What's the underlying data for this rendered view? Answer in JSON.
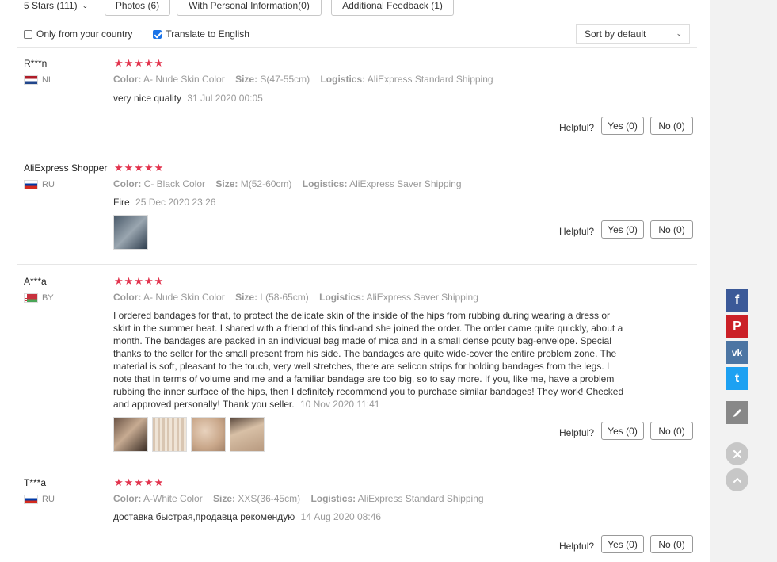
{
  "filters": {
    "stars": "5 Stars (111)",
    "photos": "Photos (6)",
    "personal": "With Personal Information(0)",
    "feedback": "Additional Feedback (1)"
  },
  "options": {
    "only_country": "Only from your country",
    "translate": "Translate to English",
    "sort": "Sort by default"
  },
  "labels": {
    "color": "Color:",
    "size": "Size:",
    "logistics": "Logistics:",
    "helpful": "Helpful?"
  },
  "reviews": [
    {
      "user": "R***n",
      "country": "NL",
      "stars": "★★★★★",
      "color": "A- Nude Skin Color",
      "size": "S(47-55cm)",
      "logistics": "AliExpress Standard Shipping",
      "text": "very nice quality",
      "date": "31 Jul 2020 00:05",
      "yes": "Yes (0)",
      "no": "No (0)"
    },
    {
      "user": "AliExpress Shopper",
      "country": "RU",
      "stars": "★★★★★",
      "color": "C- Black Color",
      "size": "M(52-60cm)",
      "logistics": "AliExpress Saver Shipping",
      "text": "Fire",
      "date": "25 Dec 2020 23:26",
      "yes": "Yes (0)",
      "no": "No (0)"
    },
    {
      "user": "A***a",
      "country": "BY",
      "stars": "★★★★★",
      "color": "A- Nude Skin Color",
      "size": "L(58-65cm)",
      "logistics": "AliExpress Saver Shipping",
      "text": "I ordered bandages for that, to protect the delicate skin of the inside of the hips from rubbing during wearing a dress or skirt in the summer heat. I shared with a friend of this find-and she joined the order. The order came quite quickly, about a month. The bandages are packed in an individual bag made of mica and in a small dense pouty bag-envelope. Special thanks to the seller for the small present from his side. The bandages are quite wide-cover the entire problem zone. The material is soft, pleasant to the touch, very well stretches, there are selicon strips for holding bandages from the legs. I note that in terms of volume and me and a familiar bandage are too big, so to say more. If you, like me, have a problem rubbing the inner surface of the hips, then I definitely recommend you to purchase similar bandages! They work! Checked and approved personally! Thank you seller.",
      "date": "10 Nov 2020 11:41",
      "yes": "Yes (0)",
      "no": "No (0)"
    },
    {
      "user": "T***a",
      "country": "RU",
      "stars": "★★★★★",
      "color": "A-White Color",
      "size": "XXS(36-45cm)",
      "logistics": "AliExpress Standard Shipping",
      "text": "доставка быстрая,продавца рекомендую",
      "date": "14 Aug 2020 08:46",
      "yes": "Yes (0)",
      "no": "No (0)"
    }
  ],
  "social": {
    "facebook": "f",
    "pinterest": "P",
    "vk": "vk",
    "twitter": "t"
  },
  "colors": {
    "star": "#e2344e",
    "facebook": "#3b5998",
    "pinterest": "#cb2027",
    "vk": "#4c75a3",
    "twitter": "#1da1f2",
    "edit": "#888888"
  }
}
